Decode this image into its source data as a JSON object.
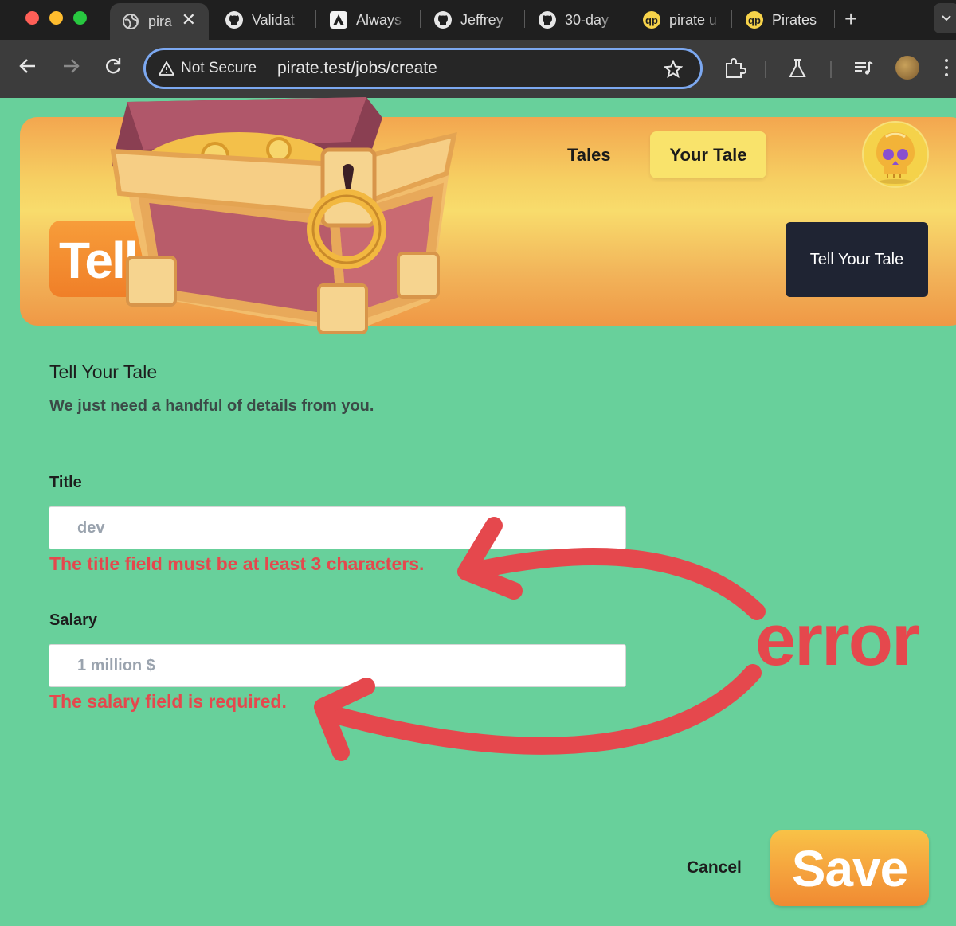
{
  "browser": {
    "tabs": [
      {
        "label": "pira",
        "icon": "globe-icon",
        "active": true
      },
      {
        "label": "Validat",
        "icon": "github-icon"
      },
      {
        "label": "Always",
        "icon": "adonis-icon"
      },
      {
        "label": "Jeffrey",
        "icon": "github-icon"
      },
      {
        "label": "30-day",
        "icon": "github-icon"
      },
      {
        "label": "pirate u",
        "icon": "pirate-logo-icon"
      },
      {
        "label": "Pirates",
        "icon": "pirate-logo-icon"
      }
    ],
    "close_glyph": "✕",
    "new_tab_glyph": "+",
    "security_label": "Not Secure",
    "url": "pirate.test/jobs/create"
  },
  "nav": {
    "tales": "Tales",
    "your_tale": "Your Tale",
    "cta": "Tell Your Tale"
  },
  "hero": {
    "title": "Tell"
  },
  "form": {
    "heading": "Tell Your Tale",
    "subheading": "We just need a handful of details from you.",
    "title_field": {
      "label": "Title",
      "value": "dev",
      "error": "The title field must be at least 3 characters."
    },
    "salary_field": {
      "label": "Salary",
      "value": "1 million $",
      "error": "The salary field is required."
    },
    "cancel": "Cancel",
    "save": "Save"
  },
  "annotation": {
    "word": "error",
    "color": "#e5484d"
  },
  "colors": {
    "page_bg": "#68d09b",
    "nav_active_bg": "#f9e36b",
    "cta_bg": "#1f2433",
    "error": "#e5484d"
  }
}
